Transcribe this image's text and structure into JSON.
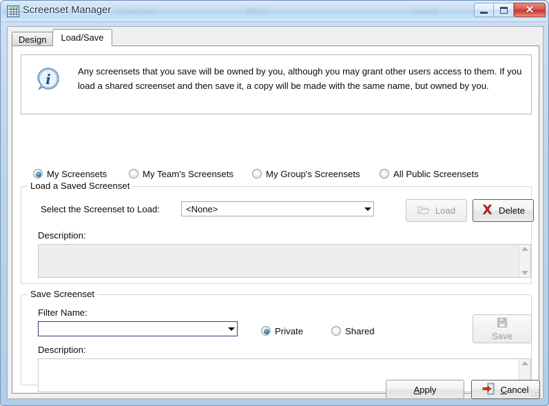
{
  "window": {
    "title": "Screenset Manager",
    "icon": "grid-table-icon",
    "ghost_text": [
      "Screenset",
      "Menu",
      "Search"
    ],
    "buttons": {
      "minimize": "minimize-button",
      "maximize": "maximize-button",
      "close": "close-button"
    }
  },
  "tabs": [
    {
      "label": "Design",
      "active": false
    },
    {
      "label": "Load/Save",
      "active": true
    }
  ],
  "info": {
    "icon": "info-icon",
    "text": "Any screensets that you save will be owned by you, although you may grant other users access to them. If you load a shared screenset  and then save it, a copy will be made with the same name, but owned by you."
  },
  "scope_radios": [
    {
      "label": "My Screensets",
      "selected": true
    },
    {
      "label": "My Team's Screensets",
      "selected": false
    },
    {
      "label": "My Group's Screensets",
      "selected": false
    },
    {
      "label": "All Public Screensets",
      "selected": false
    }
  ],
  "load_group": {
    "title": "Load a Saved Screenset",
    "select_label": "Select the Screenset to Load:",
    "combo_value": "<None>",
    "combo_placeholder": "<None>",
    "description_label": "Description:",
    "description_value": "",
    "load_button": {
      "label": "Load",
      "icon": "open-folder-icon",
      "enabled": false
    },
    "delete_button": {
      "label": "Delete",
      "icon": "red-x-icon",
      "enabled": true
    }
  },
  "save_group": {
    "title": "Save Screenset",
    "filter_name_label": "Filter Name:",
    "filter_name_value": "",
    "filter_name_placeholder": "",
    "visibility_radios": [
      {
        "label": "Private",
        "selected": true
      },
      {
        "label": "Shared",
        "selected": false
      }
    ],
    "description_label": "Description:",
    "description_value": "",
    "save_button": {
      "label": "Save",
      "icon": "floppy-disk-icon",
      "enabled": false
    }
  },
  "footer": {
    "apply": {
      "label": "Apply",
      "mnemonic": "A"
    },
    "cancel": {
      "label": "Cancel",
      "mnemonic": "C",
      "icon": "exit-door-icon"
    }
  },
  "colors": {
    "titlebar_accent": "#b4d0ec",
    "close_red": "#c6352c",
    "radio_blue": "#2a7fc0",
    "delete_x_red": "#cc2020",
    "focus_border": "#2c3f73"
  }
}
